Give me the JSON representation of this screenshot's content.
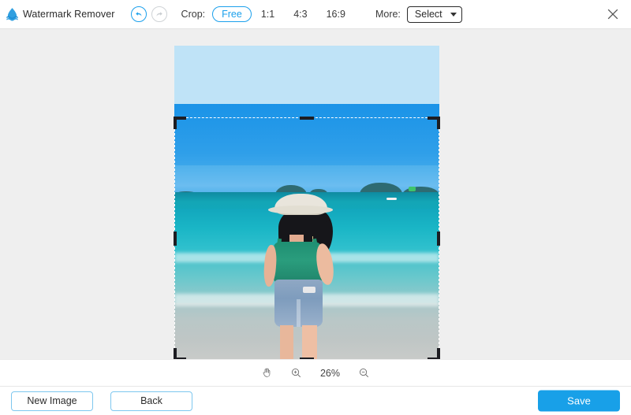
{
  "app": {
    "title": "Watermark Remover",
    "logo_icon": "water-drop-icon"
  },
  "toolbar": {
    "undo_icon": "undo-arrow-icon",
    "redo_icon": "redo-arrow-icon",
    "crop_label": "Crop:",
    "ratios": [
      {
        "label": "Free",
        "active": true
      },
      {
        "label": "1:1",
        "active": false
      },
      {
        "label": "4:3",
        "active": false
      },
      {
        "label": "16:9",
        "active": false
      }
    ],
    "more_label": "More:",
    "select_value": "Select",
    "select_caret_icon": "chevron-down-icon",
    "close_icon": "close-icon"
  },
  "zoombar": {
    "pan_icon": "hand-pan-icon",
    "zoom_in_icon": "zoom-in-icon",
    "zoom_level": "26%",
    "zoom_out_icon": "zoom-out-icon"
  },
  "footer": {
    "new_image_label": "New Image",
    "back_label": "Back",
    "save_label": "Save"
  },
  "colors": {
    "accent": "#18a0e8",
    "accent_outline": "#1ba0ec",
    "canvas_background": "#efefef",
    "disabled": "#cfd3d6",
    "handle": "#1d1d22"
  }
}
